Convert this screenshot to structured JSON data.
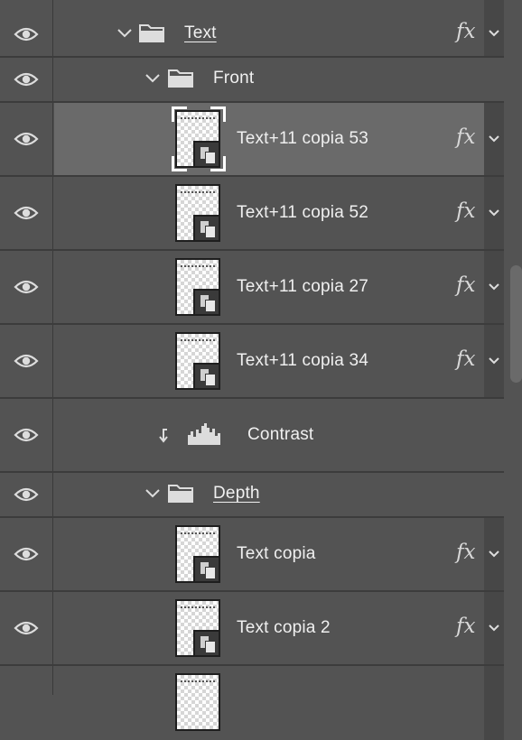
{
  "panel": "layers",
  "icons": {
    "visibility": "eye-icon",
    "group": "folder-icon",
    "expand": "chevron-down-icon",
    "effects": "fx-icon",
    "clipping": "clipping-arrow-icon",
    "adjustment": "histogram-icon"
  },
  "layers": [
    {
      "name": "Text",
      "type": "group",
      "underlined": true,
      "fx": "fx"
    },
    {
      "name": "Front",
      "type": "group"
    },
    {
      "name": "Text+11 copia 53",
      "type": "smart-object",
      "selected": true,
      "fx": "fx"
    },
    {
      "name": "Text+11 copia 52",
      "type": "smart-object",
      "fx": "fx"
    },
    {
      "name": "Text+11 copia 27",
      "type": "smart-object",
      "fx": "fx"
    },
    {
      "name": "Text+11 copia 34",
      "type": "smart-object",
      "fx": "fx"
    },
    {
      "name": "Contrast",
      "type": "adjustment",
      "clipped": true
    },
    {
      "name": "Depth",
      "type": "group",
      "underlined": true
    },
    {
      "name": "Text copia",
      "type": "smart-object",
      "fx": "fx"
    },
    {
      "name": "Text copia 2",
      "type": "smart-object",
      "fx": "fx"
    },
    {
      "name": "",
      "type": "smart-object",
      "partial": true
    }
  ],
  "colors": {
    "panel_bg": "#535353",
    "selected_row": "#6a6a6a",
    "text": "#f0f0f0"
  }
}
